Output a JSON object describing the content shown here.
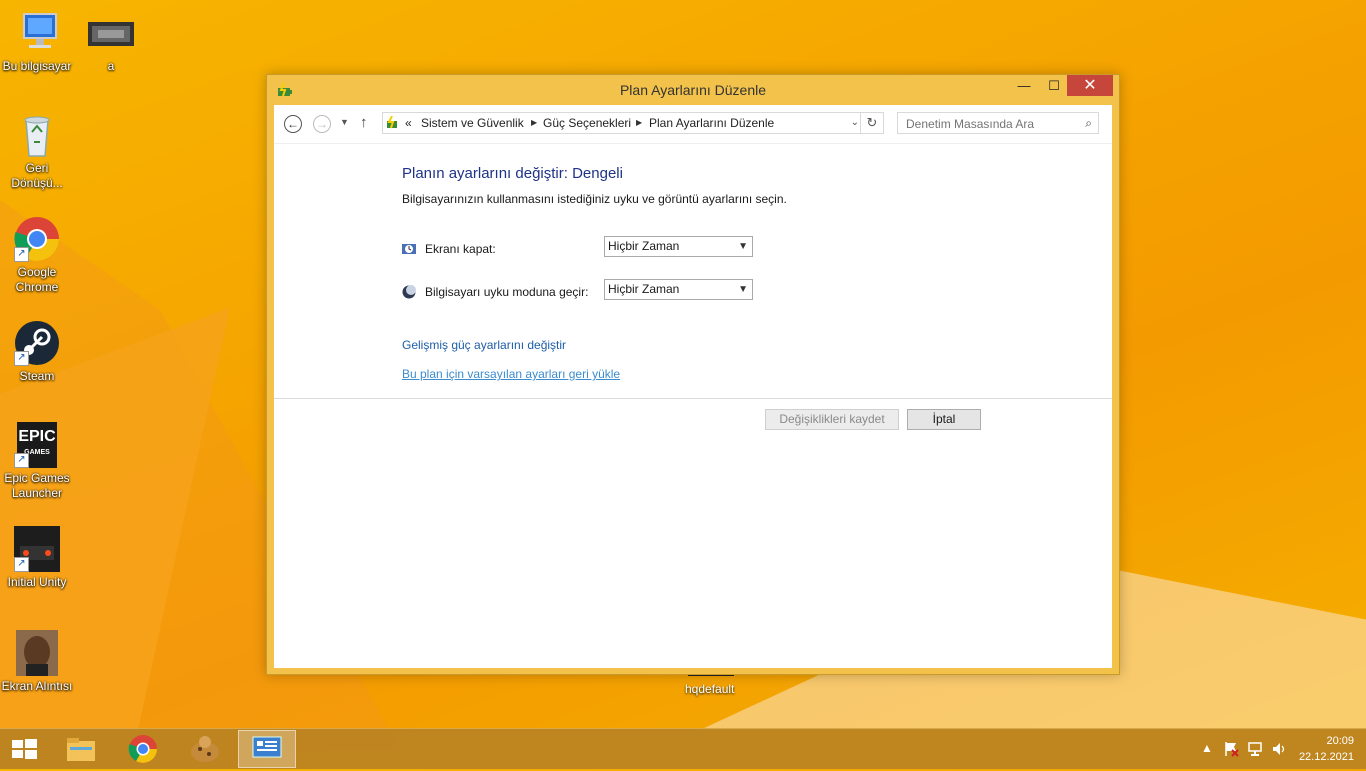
{
  "desktop": {
    "icons": [
      {
        "label": "Bu bilgisayar"
      },
      {
        "label": "a"
      },
      {
        "label": "Geri Dönüşü..."
      },
      {
        "label": "Google Chrome"
      },
      {
        "label": "Steam"
      },
      {
        "label": "Epic Games Launcher"
      },
      {
        "label": "Initial Unity"
      },
      {
        "label": "Ekran Alıntısı"
      }
    ],
    "hqdefault_label": "hqdefault",
    "epic_logo_text": "EPIC",
    "epic_logo_sub": "GAMES"
  },
  "window": {
    "title": "Plan Ayarlarını Düzenle",
    "controls": {
      "minimize": "—",
      "maximize": "☐",
      "close": "✕"
    },
    "breadcrumb": {
      "prefix": "«",
      "items": [
        "Sistem ve Güvenlik",
        "Güç Seçenekleri",
        "Plan Ayarlarını Düzenle"
      ]
    },
    "search_placeholder": "Denetim Masasında Ara",
    "heading": "Planın ayarlarını değiştir: Dengeli",
    "subtext": "Bilgisayarınızın kullanmasını istediğiniz uyku ve görüntü ayarlarını seçin.",
    "settings": [
      {
        "label": "Ekranı kapat:",
        "value": "Hiçbir Zaman"
      },
      {
        "label": "Bilgisayarı uyku moduna geçir:",
        "value": "Hiçbir Zaman"
      }
    ],
    "links": {
      "advanced": "Gelişmiş güç ayarlarını değiştir",
      "restore": "Bu plan için varsayılan ayarları geri yükle"
    },
    "buttons": {
      "save": "Değişiklikleri kaydet",
      "cancel": "İptal"
    }
  },
  "taskbar": {
    "time": "20:09",
    "date": "22.12.2021"
  },
  "colors": {
    "accent_heading": "#1e3287",
    "link": "#1d5ea8",
    "close_button": "#c7463c"
  }
}
